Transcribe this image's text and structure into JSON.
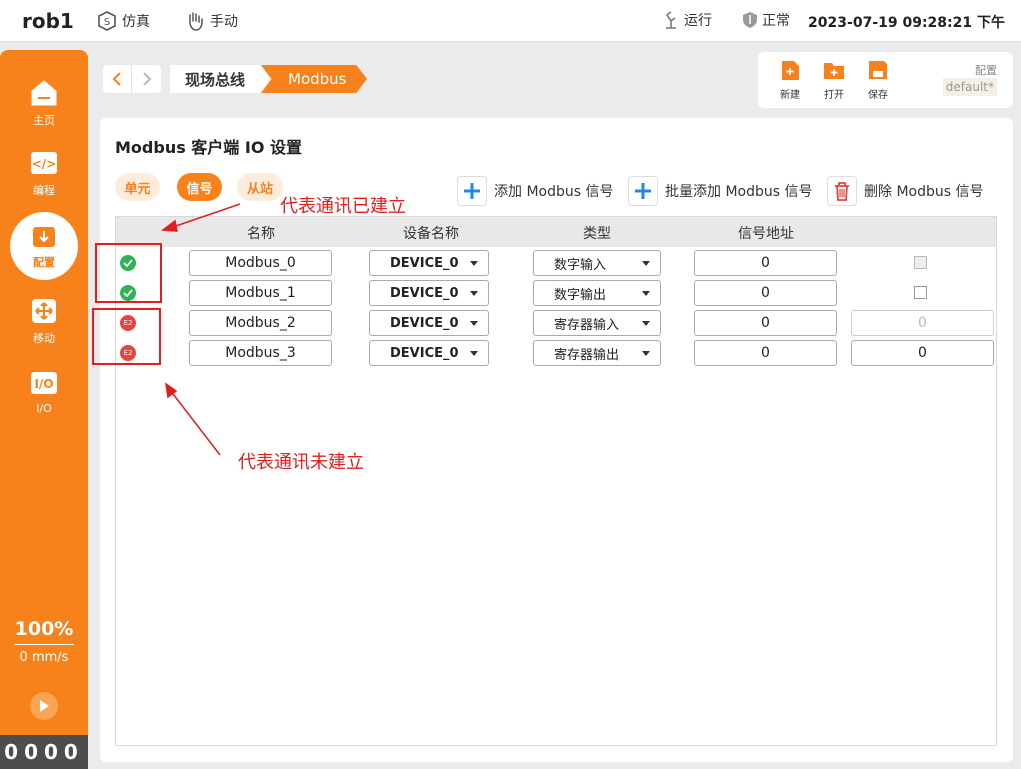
{
  "topbar": {
    "robot_name": "rob1",
    "mode_sim": "仿真",
    "mode_manual": "手动",
    "run_state": "运行",
    "status": "正常",
    "datetime": "2023-07-19 09:28:21 下午"
  },
  "sidebar": {
    "items": [
      {
        "label": "主页",
        "icon": "home-icon"
      },
      {
        "label": "编程",
        "icon": "code-icon"
      },
      {
        "label": "配置",
        "icon": "config-icon"
      },
      {
        "label": "移动",
        "icon": "move-icon"
      },
      {
        "label": "I/O",
        "icon": "io-icon"
      }
    ],
    "speed_percent": "100%",
    "speed_value": "0 mm/s",
    "counter": "0000"
  },
  "breadcrumb": {
    "items": [
      "现场总线",
      "Modbus"
    ]
  },
  "config_panel": {
    "new_label": "新建",
    "open_label": "打开",
    "save_label": "保存",
    "config_label": "配置",
    "config_name": "default*"
  },
  "main": {
    "title": "Modbus 客户端 IO 设置",
    "tabs": [
      "单元",
      "信号",
      "从站"
    ],
    "active_tab": "信号",
    "actions": {
      "add": "添加 Modbus 信号",
      "batch_add": "批量添加 Modbus 信号",
      "delete": "删除 Modbus 信号"
    },
    "columns": [
      "名称",
      "设备名称",
      "类型",
      "信号地址"
    ],
    "rows": [
      {
        "status": "ok",
        "status_text": "",
        "name": "Modbus_0",
        "device": "DEVICE_0",
        "type": "数字输入",
        "address": "0",
        "extra_kind": "checkbox",
        "extra_value": ""
      },
      {
        "status": "ok",
        "status_text": "",
        "name": "Modbus_1",
        "device": "DEVICE_0",
        "type": "数字输出",
        "address": "0",
        "extra_kind": "checkbox",
        "extra_value": ""
      },
      {
        "status": "err",
        "status_text": "E2",
        "name": "Modbus_2",
        "device": "DEVICE_0",
        "type": "寄存器输入",
        "address": "0",
        "extra_kind": "input-disabled",
        "extra_value": "0"
      },
      {
        "status": "err",
        "status_text": "E2",
        "name": "Modbus_3",
        "device": "DEVICE_0",
        "type": "寄存器输出",
        "address": "0",
        "extra_kind": "input",
        "extra_value": "0"
      }
    ]
  },
  "annotations": {
    "established": "代表通讯已建立",
    "not_established": "代表通讯未建立",
    "color": "#e02020"
  },
  "colors": {
    "accent": "#f7821b",
    "ok": "#2eb352",
    "error": "#e8433f"
  }
}
